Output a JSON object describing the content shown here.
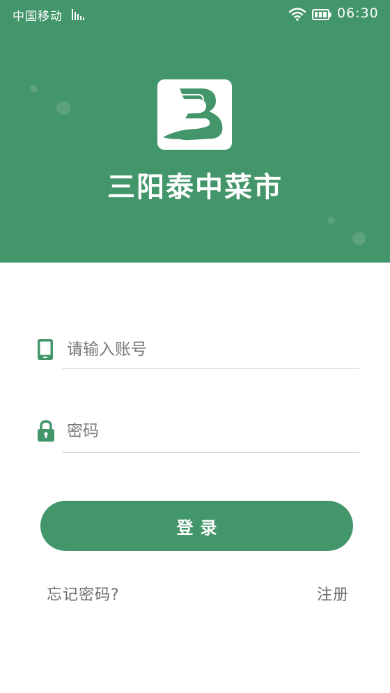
{
  "status_bar": {
    "carrier": "中国移动",
    "time": "06:30",
    "icons": [
      "signal-icon",
      "wifi-icon",
      "battery-icon"
    ]
  },
  "header": {
    "brand": "三阳泰中菜市",
    "logo_icon": "brand-logo-icon"
  },
  "login_form": {
    "account": {
      "placeholder": "请输入账号",
      "value": "",
      "icon": "phone-icon"
    },
    "password": {
      "placeholder": "密码",
      "value": "",
      "icon": "lock-icon"
    },
    "login_label": "登录",
    "forgot_label": "忘记密码?",
    "register_label": "注册"
  },
  "colors": {
    "primary": "#43956a",
    "text_muted": "#6b6b6b",
    "divider": "#d2d2d2"
  }
}
